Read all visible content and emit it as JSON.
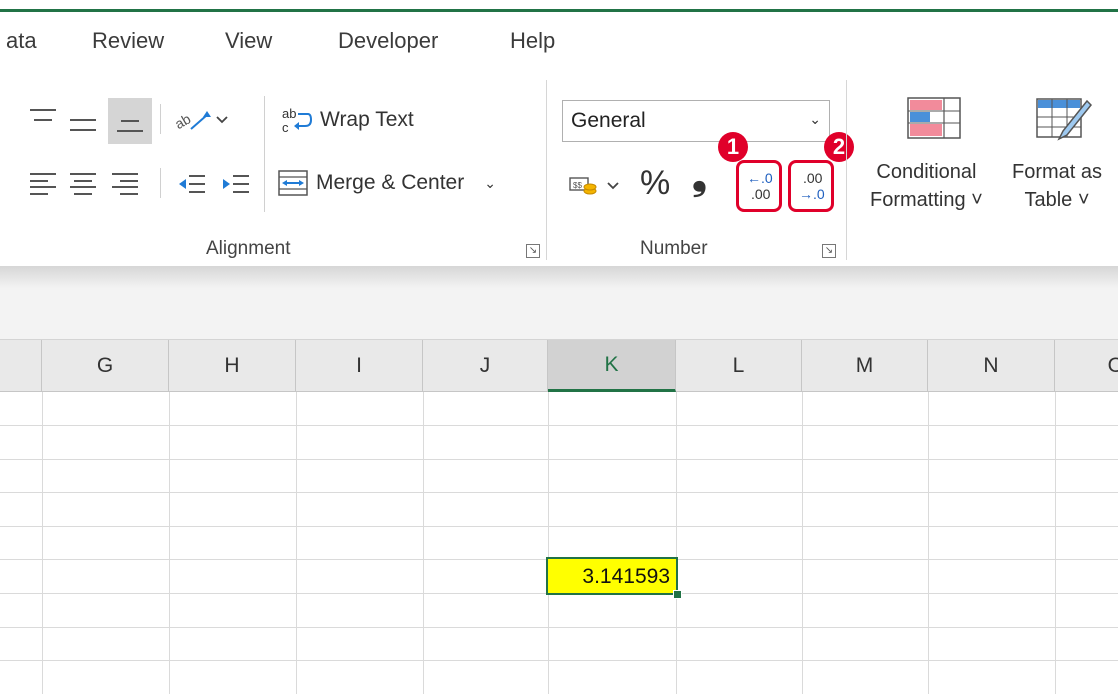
{
  "menu": {
    "items": [
      "ata",
      "Review",
      "View",
      "Developer",
      "Help"
    ]
  },
  "alignment": {
    "wrap_text_label": "Wrap Text",
    "merge_center_label": "Merge & Center",
    "group_label": "Alignment"
  },
  "number": {
    "format_value": "General",
    "percent_symbol": "%",
    "comma_symbol": "❟",
    "decrease_decimal": {
      "badge": "1",
      "top": "←.0",
      "bottom": ".00"
    },
    "increase_decimal": {
      "badge": "2",
      "top": ".00",
      "bottom": "→.0"
    },
    "group_label": "Number"
  },
  "styles": {
    "conditional_formatting_line1": "Conditional",
    "conditional_formatting_line2": "Formatting ˅",
    "format_as_table_line1": "Format as",
    "format_as_table_line2": "Table ˅"
  },
  "columns": [
    "G",
    "H",
    "I",
    "J",
    "K",
    "L",
    "M",
    "N",
    "O"
  ],
  "active_column": "K",
  "active_cell_value": "3.141593",
  "colors": {
    "excel_green": "#217346",
    "highlight": "#ffff00",
    "callout_red": "#e0002a"
  }
}
